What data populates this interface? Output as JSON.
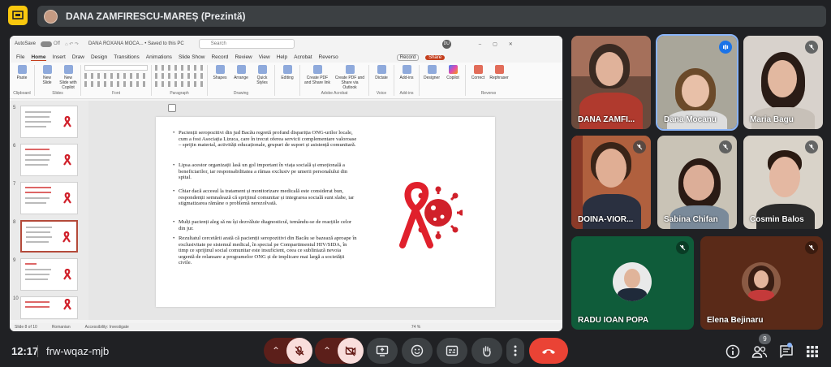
{
  "presenter": {
    "name": "DANA ZAMFIRESCU-MAREȘ (Prezintă)"
  },
  "ppt": {
    "autosave": "AutoSave",
    "autosave_state": "Off",
    "doc_title": "DANA ROXANA MOCA... • Saved to this PC",
    "search_placeholder": "Search",
    "user_initials": "DU",
    "tabs": [
      "File",
      "Home",
      "Insert",
      "Draw",
      "Design",
      "Transitions",
      "Animations",
      "Slide Show",
      "Record",
      "Review",
      "View",
      "Help",
      "Acrobat",
      "Reverso"
    ],
    "record": "Record",
    "share": "Share",
    "groups": [
      {
        "label": "Clipboard",
        "buttons": [
          "Paste"
        ]
      },
      {
        "label": "Slides",
        "buttons": [
          "New Slide",
          "New Slide with Copilot"
        ]
      },
      {
        "label": "Font",
        "buttons": []
      },
      {
        "label": "Paragraph",
        "buttons": []
      },
      {
        "label": "Drawing",
        "buttons": [
          "Shapes",
          "Arrange",
          "Quick Styles"
        ]
      },
      {
        "label": "",
        "buttons": [
          "Editing"
        ]
      },
      {
        "label": "Adobe Acrobat",
        "buttons": [
          "Create PDF and Share link",
          "Create PDF and Share via Outlook"
        ]
      },
      {
        "label": "Voice",
        "buttons": [
          "Dictate"
        ]
      },
      {
        "label": "Add-ins",
        "buttons": [
          "Add-ins"
        ]
      },
      {
        "label": "",
        "buttons": [
          "Designer",
          "Copilot"
        ]
      },
      {
        "label": "Reverso",
        "buttons": [
          "Correct",
          "Rephraser"
        ]
      }
    ],
    "thumb_numbers": [
      "5",
      "6",
      "7",
      "8",
      "9",
      "10"
    ],
    "status": {
      "slide": "Slide 8 of 10",
      "lang": "Romanian",
      "access": "Accessibility: Investigate",
      "zoom": "74 %"
    }
  },
  "slide": {
    "bullets": [
      "Pacienții seropozitivi din jud Bacău regretă profund dispariția ONG-urilor locale, cum a fost Asociația Lizuca, care în trecut oferea servicii complementare valoroase – sprijin material, activități educaționale, grupuri de suport și asistență comunitară.",
      "Lipsa acestor organizații lasă un gol important în viața socială și emoțională a beneficiarilor, iar responsabilitatea a rămas exclusiv pe umerii personalului din spital.",
      "Chiar dacă accesul la tratament și monitorizare medicală este considerat bun, respondenții semnalează că sprijinul comunitar și integrarea socială sunt slabe, iar stigmatizarea rămâne o problemă nerezolvată.",
      " Mulți pacienți aleg să nu își dezvăluie diagnosticul, temându-se de reacțiile celor din jur.",
      "Rezultatul cercetării arată că pacienții seropozitivi din Bacău se bazează aproape în exclusivitate pe sistemul medical, în special pe Compartimentul HIV/SIDA, în timp ce sprijinul social comunitar este insuficient, ceea ce subliniază nevoia urgentă de relansare a programelor ONG și de implicare mai largă a societății civile."
    ]
  },
  "participants": [
    {
      "name": "DANA ZAMFI...",
      "muted": false
    },
    {
      "name": "Dana Mocanu",
      "muted": false,
      "speaking": true
    },
    {
      "name": "Maria Bagu",
      "muted": true
    },
    {
      "name": "DOINA-VIOR...",
      "muted": true
    },
    {
      "name": "Sabina Chifan",
      "muted": true
    },
    {
      "name": "Cosmin Balos",
      "muted": true
    },
    {
      "name": "RADU IOAN POPA",
      "muted": true
    },
    {
      "name": "Elena Bejinaru",
      "muted": true
    }
  ],
  "bottom": {
    "time": "12:17",
    "meeting_code": "frw-wqaz-mjb",
    "people_count": "9"
  },
  "colors": {
    "bg": "#202124",
    "hangup": "#ea4335",
    "mic_off": "#f9dedc",
    "accent_red": "#c43e1c"
  }
}
